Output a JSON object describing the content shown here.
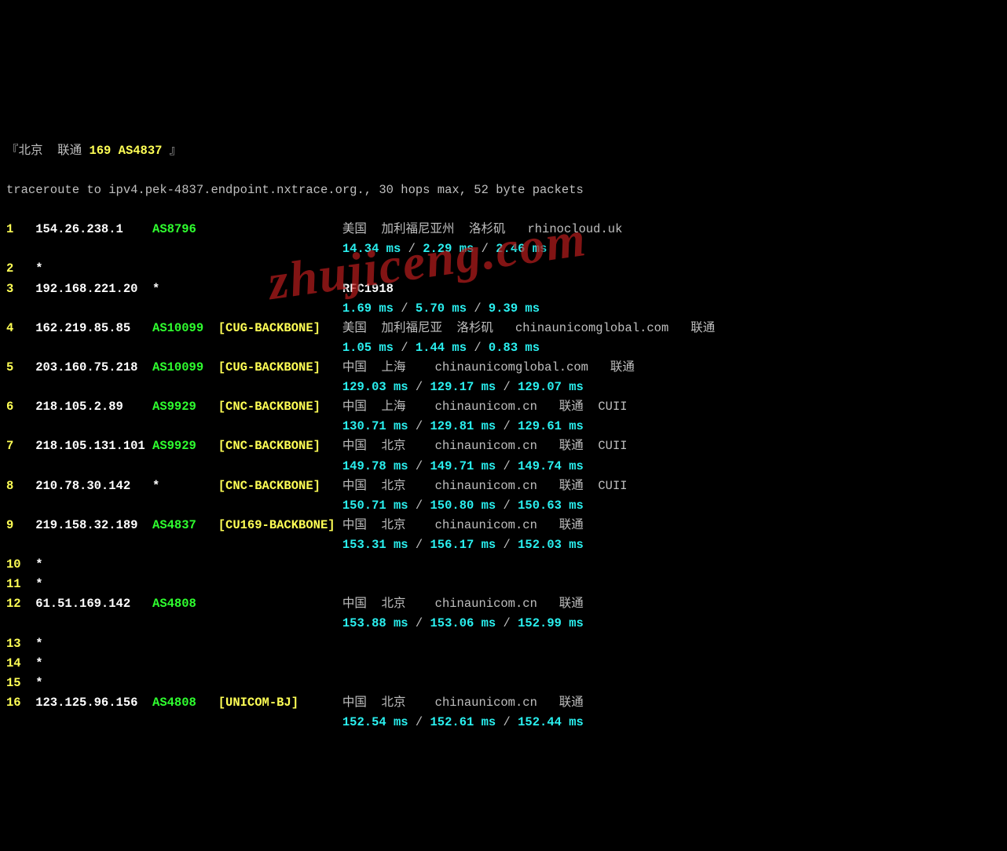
{
  "header": {
    "bracket_open": "『",
    "location": "北京  联通",
    "asn_line": "169 AS4837",
    "bracket_close": "』"
  },
  "traceroute_line": "traceroute to ipv4.pek-4837.endpoint.nxtrace.org., 30 hops max, 52 byte packets",
  "watermark": "zhujiceng.com",
  "hops": [
    {
      "num": "1",
      "ip": "154.26.238.1",
      "asn": "AS8796",
      "tag": "",
      "geo": "美国  加利福尼亚州  洛杉矶   rhinocloud.uk",
      "t1": "14.34 ms",
      "t2": "2.29 ms",
      "t3": "2.46 ms"
    },
    {
      "num": "2",
      "ip": "*",
      "asn": "",
      "tag": "",
      "geo": "",
      "t1": "",
      "t2": "",
      "t3": ""
    },
    {
      "num": "3",
      "ip": "192.168.221.20",
      "asn": "*",
      "tag": "",
      "geo": "RFC1918",
      "t1": "1.69 ms",
      "t2": "5.70 ms",
      "t3": "9.39 ms"
    },
    {
      "num": "4",
      "ip": "162.219.85.85",
      "asn": "AS10099",
      "tag": "[CUG-BACKBONE]",
      "geo": "美国  加利福尼亚  洛杉矶   chinaunicomglobal.com   联通",
      "t1": "1.05 ms",
      "t2": "1.44 ms",
      "t3": "0.83 ms"
    },
    {
      "num": "5",
      "ip": "203.160.75.218",
      "asn": "AS10099",
      "tag": "[CUG-BACKBONE]",
      "geo": "中国  上海    chinaunicomglobal.com   联通",
      "t1": "129.03 ms",
      "t2": "129.17 ms",
      "t3": "129.07 ms"
    },
    {
      "num": "6",
      "ip": "218.105.2.89",
      "asn": "AS9929",
      "tag": "[CNC-BACKBONE]",
      "geo": "中国  上海    chinaunicom.cn   联通  CUII",
      "t1": "130.71 ms",
      "t2": "129.81 ms",
      "t3": "129.61 ms"
    },
    {
      "num": "7",
      "ip": "218.105.131.101",
      "asn": "AS9929",
      "tag": "[CNC-BACKBONE]",
      "geo": "中国  北京    chinaunicom.cn   联通  CUII",
      "t1": "149.78 ms",
      "t2": "149.71 ms",
      "t3": "149.74 ms"
    },
    {
      "num": "8",
      "ip": "210.78.30.142",
      "asn": "*",
      "tag": "[CNC-BACKBONE]",
      "geo": "中国  北京    chinaunicom.cn   联通  CUII",
      "t1": "150.71 ms",
      "t2": "150.80 ms",
      "t3": "150.63 ms"
    },
    {
      "num": "9",
      "ip": "219.158.32.189",
      "asn": "AS4837",
      "tag": "[CU169-BACKBONE]",
      "geo": "中国  北京    chinaunicom.cn   联通",
      "t1": "153.31 ms",
      "t2": "156.17 ms",
      "t3": "152.03 ms"
    },
    {
      "num": "10",
      "ip": "*",
      "asn": "",
      "tag": "",
      "geo": "",
      "t1": "",
      "t2": "",
      "t3": ""
    },
    {
      "num": "11",
      "ip": "*",
      "asn": "",
      "tag": "",
      "geo": "",
      "t1": "",
      "t2": "",
      "t3": ""
    },
    {
      "num": "12",
      "ip": "61.51.169.142",
      "asn": "AS4808",
      "tag": "",
      "geo": "中国  北京    chinaunicom.cn   联通",
      "t1": "153.88 ms",
      "t2": "153.06 ms",
      "t3": "152.99 ms"
    },
    {
      "num": "13",
      "ip": "*",
      "asn": "",
      "tag": "",
      "geo": "",
      "t1": "",
      "t2": "",
      "t3": ""
    },
    {
      "num": "14",
      "ip": "*",
      "asn": "",
      "tag": "",
      "geo": "",
      "t1": "",
      "t2": "",
      "t3": ""
    },
    {
      "num": "15",
      "ip": "*",
      "asn": "",
      "tag": "",
      "geo": "",
      "t1": "",
      "t2": "",
      "t3": ""
    },
    {
      "num": "16",
      "ip": "123.125.96.156",
      "asn": "AS4808",
      "tag": "[UNICOM-BJ]",
      "geo": "中国  北京    chinaunicom.cn   联通",
      "t1": "152.54 ms",
      "t2": "152.61 ms",
      "t3": "152.44 ms"
    }
  ],
  "sep": " / "
}
